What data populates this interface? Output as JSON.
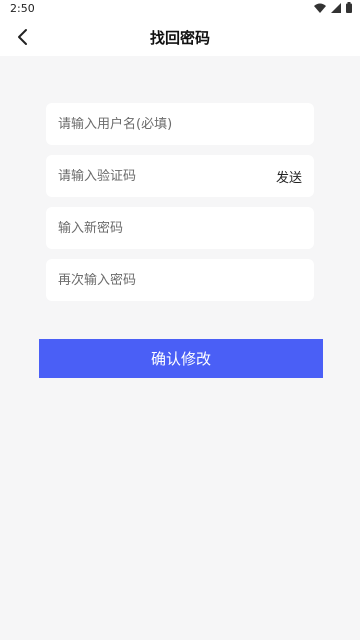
{
  "status_bar": {
    "time": "2:50",
    "icons": [
      "wifi-icon",
      "signal-icon",
      "battery-icon"
    ]
  },
  "header": {
    "title": "找回密码",
    "back_icon": "chevron-left-icon"
  },
  "form": {
    "username": {
      "value": "",
      "placeholder": "请输入用户名(必填)"
    },
    "code": {
      "value": "",
      "placeholder": "请输入验证码",
      "send_label": "发送"
    },
    "new_password": {
      "value": "",
      "placeholder": "输入新密码"
    },
    "confirm_password": {
      "value": "",
      "placeholder": "再次输入密码"
    },
    "submit_label": "确认修改"
  },
  "colors": {
    "accent": "#4a5ff6",
    "background": "#f6f6f7",
    "surface": "#ffffff"
  }
}
